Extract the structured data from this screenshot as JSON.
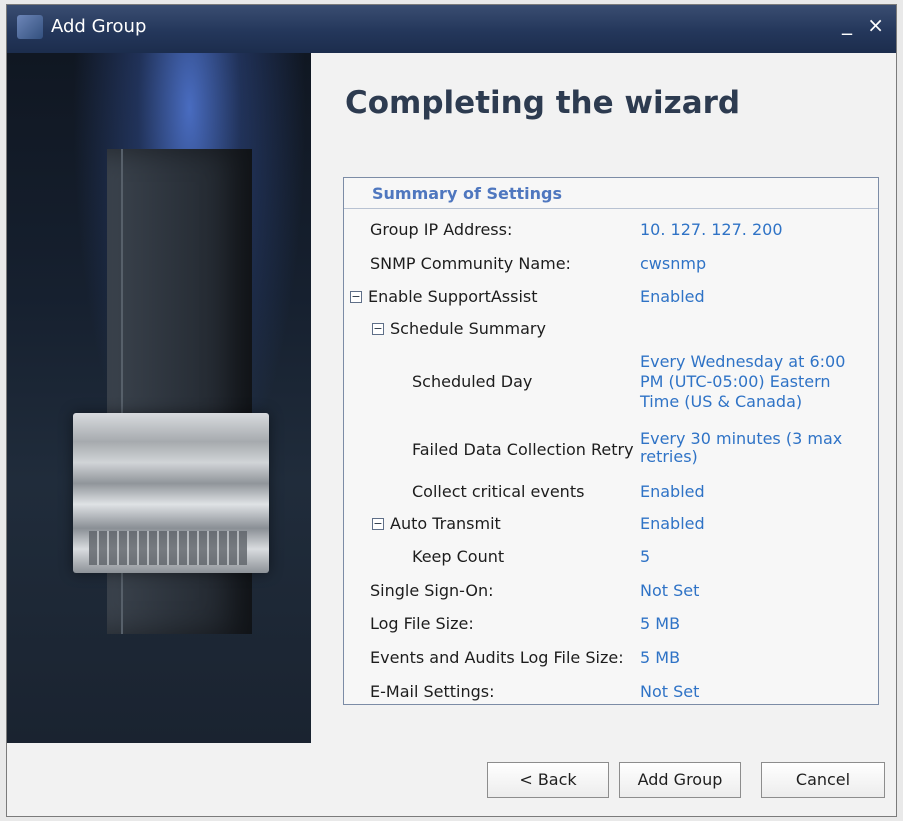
{
  "window": {
    "title": "Add Group",
    "minimize_glyph": "_",
    "close_glyph": "×"
  },
  "page": {
    "heading": "Completing the wizard"
  },
  "summary": {
    "title": "Summary of Settings",
    "rows": [
      {
        "label": "Group IP Address:",
        "value": "10. 127. 127. 200"
      },
      {
        "label": "SNMP Community Name:",
        "value": "cwsnmp"
      },
      {
        "label": "Enable SupportAssist",
        "value": "Enabled",
        "toggle": "−"
      },
      {
        "label": "Schedule Summary",
        "value": "",
        "toggle": "−"
      },
      {
        "label": "Scheduled Day",
        "value": "Every Wednesday at 6:00\nPM (UTC-05:00) Eastern\nTime (US & Canada)"
      },
      {
        "label": "Failed Data Collection Retry",
        "value": "Every 30 minutes (3 max\nretries)"
      },
      {
        "label": "Collect critical events",
        "value": "Enabled"
      },
      {
        "label": "Auto Transmit",
        "value": "Enabled",
        "toggle": "−"
      },
      {
        "label": "Keep Count",
        "value": "5"
      },
      {
        "label": "Single Sign-On:",
        "value": "Not Set"
      },
      {
        "label": "Log File Size:",
        "value": "5 MB"
      },
      {
        "label": "Events and Audits Log File Size:",
        "value": "5 MB"
      },
      {
        "label": "E-Mail Settings:",
        "value": "Not Set"
      }
    ]
  },
  "buttons": {
    "back": "< Back",
    "add_group": "Add Group",
    "cancel": "Cancel"
  },
  "icons": {
    "app": "app-icon",
    "hero": "server-hardware-image"
  }
}
